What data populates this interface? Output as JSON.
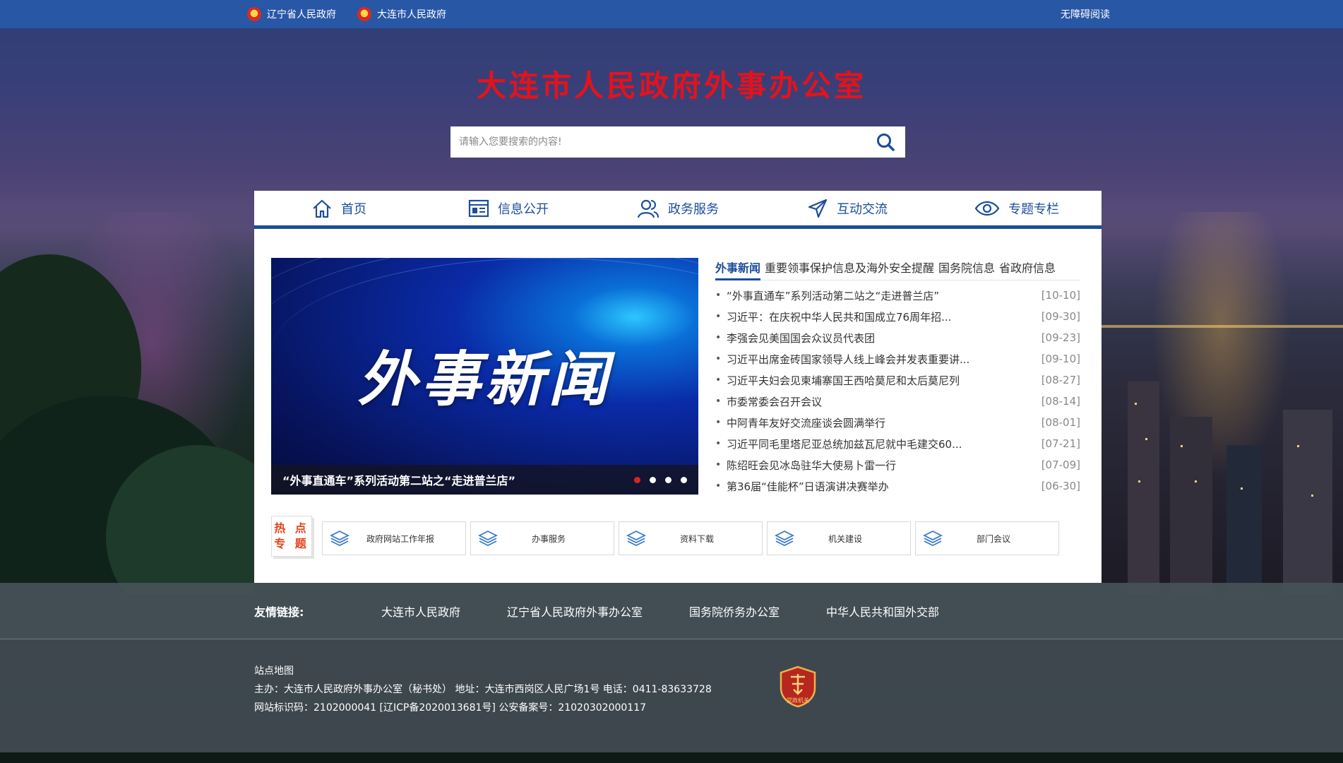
{
  "topbar": {
    "links": [
      {
        "label": "辽宁省人民政府"
      },
      {
        "label": "大连市人民政府"
      }
    ],
    "accessibility": "无障碍阅读"
  },
  "site_title": "大连市人民政府外事办公室",
  "search": {
    "placeholder": "请输入您要搜索的内容!"
  },
  "nav": {
    "items": [
      {
        "label": "首页",
        "icon": "home-icon"
      },
      {
        "label": "信息公开",
        "icon": "info-icon"
      },
      {
        "label": "政务服务",
        "icon": "users-icon"
      },
      {
        "label": "互动交流",
        "icon": "send-icon"
      },
      {
        "label": "专题专栏",
        "icon": "eye-icon"
      }
    ]
  },
  "slider": {
    "heading": "外事新闻",
    "caption": "“外事直通车”系列活动第二站之“走进普兰店”",
    "dots": 4,
    "active_dot": 0
  },
  "news": {
    "tabs": [
      {
        "label": "外事新闻",
        "active": true
      },
      {
        "label": "重要领事保护信息及海外安全提醒",
        "active": false
      },
      {
        "label": "国务院信息",
        "active": false
      },
      {
        "label": "省政府信息",
        "active": false
      }
    ],
    "items": [
      {
        "title": "“外事直通车”系列活动第二站之“走进普兰店”",
        "date": "[10-10]"
      },
      {
        "title": "习近平：在庆祝中华人民共和国成立76周年招...",
        "date": "[09-30]"
      },
      {
        "title": "李强会见美国国会众议员代表团",
        "date": "[09-23]"
      },
      {
        "title": "习近平出席金砖国家领导人线上峰会并发表重要讲...",
        "date": "[09-10]"
      },
      {
        "title": "习近平夫妇会见柬埔寨国王西哈莫尼和太后莫尼列",
        "date": "[08-27]"
      },
      {
        "title": "市委常委会召开会议",
        "date": "[08-14]"
      },
      {
        "title": "中阿青年友好交流座谈会圆满举行",
        "date": "[08-01]"
      },
      {
        "title": "习近平同毛里塔尼亚总统加兹瓦尼就中毛建交60...",
        "date": "[07-21]"
      },
      {
        "title": "陈绍旺会见冰岛驻华大使易卜雷一行",
        "date": "[07-09]"
      },
      {
        "title": "第36届“佳能杯”日语演讲决赛举办",
        "date": "[06-30]"
      }
    ]
  },
  "hot": {
    "line1": "热 点",
    "line2": "专 题"
  },
  "topics": [
    {
      "label": "政府网站工作年报"
    },
    {
      "label": "办事服务"
    },
    {
      "label": "资料下载"
    },
    {
      "label": "机关建设"
    },
    {
      "label": "部门会议"
    }
  ],
  "friend_links": {
    "label": "友情链接:",
    "items": [
      {
        "label": "大连市人民政府"
      },
      {
        "label": "辽宁省人民政府外事办公室"
      },
      {
        "label": "国务院侨务办公室"
      },
      {
        "label": "中华人民共和国外交部"
      }
    ]
  },
  "footer": {
    "sitemap": "站点地图",
    "host": "主办：大连市人民政府外事办公室（秘书处）  地址：大连市西岗区人民广场1号  电话：0411-83633728",
    "ids": "网站标识码：2102000041 [辽ICP备2020013681号] 公安备案号：21020302000117",
    "badge_text": "党政机关"
  },
  "colors": {
    "topbar": "#2857a6",
    "title_red": "#e3131c",
    "nav_blue": "#1b4d9b",
    "dot_active": "#d8261f"
  }
}
